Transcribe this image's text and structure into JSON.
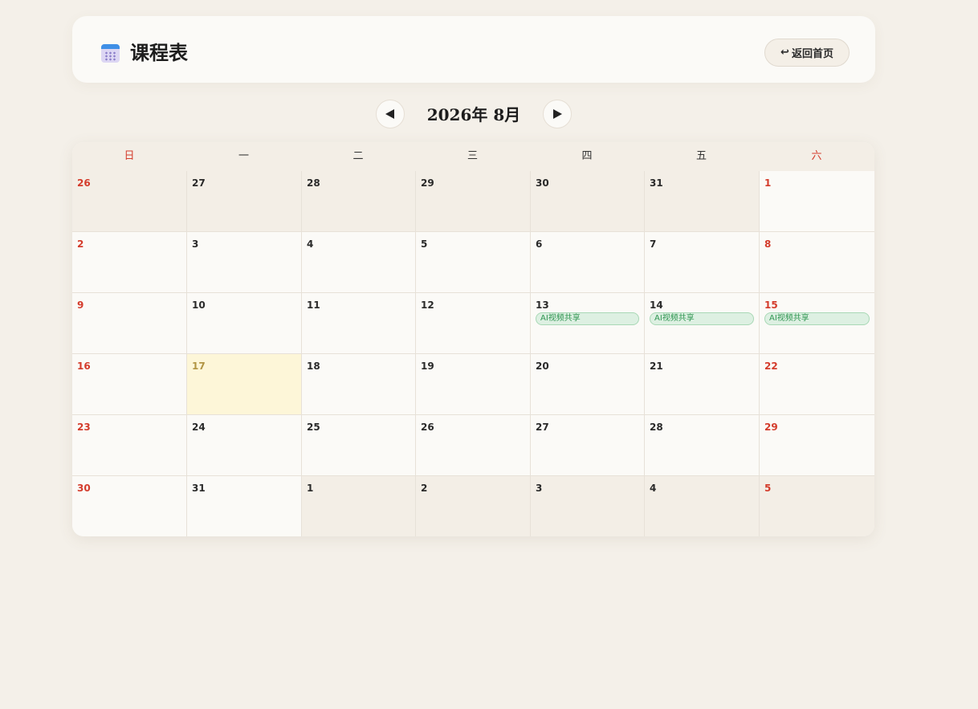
{
  "header": {
    "title": "课程表",
    "icon": "calendar-icon",
    "home_button": {
      "arrow": "↩",
      "label": "返回首页"
    }
  },
  "nav": {
    "month_label": "2026年 8月",
    "prev_icon": "triangle-left-icon",
    "next_icon": "triangle-right-icon"
  },
  "calendar": {
    "weekdays": [
      "日",
      "一",
      "二",
      "三",
      "四",
      "五",
      "六"
    ],
    "weeks": [
      [
        {
          "day": "26",
          "other": true
        },
        {
          "day": "27",
          "other": true
        },
        {
          "day": "28",
          "other": true
        },
        {
          "day": "29",
          "other": true
        },
        {
          "day": "30",
          "other": true
        },
        {
          "day": "31",
          "other": true
        },
        {
          "day": "1"
        }
      ],
      [
        {
          "day": "2"
        },
        {
          "day": "3"
        },
        {
          "day": "4"
        },
        {
          "day": "5"
        },
        {
          "day": "6"
        },
        {
          "day": "7"
        },
        {
          "day": "8"
        }
      ],
      [
        {
          "day": "9"
        },
        {
          "day": "10"
        },
        {
          "day": "11"
        },
        {
          "day": "12"
        },
        {
          "day": "13",
          "event": "AI视频共享"
        },
        {
          "day": "14",
          "event": "AI视频共享"
        },
        {
          "day": "15",
          "event": "AI视频共享"
        }
      ],
      [
        {
          "day": "16"
        },
        {
          "day": "17",
          "today": true
        },
        {
          "day": "18"
        },
        {
          "day": "19"
        },
        {
          "day": "20"
        },
        {
          "day": "21"
        },
        {
          "day": "22"
        }
      ],
      [
        {
          "day": "23"
        },
        {
          "day": "24"
        },
        {
          "day": "25"
        },
        {
          "day": "26"
        },
        {
          "day": "27"
        },
        {
          "day": "28"
        },
        {
          "day": "29"
        }
      ],
      [
        {
          "day": "30"
        },
        {
          "day": "31"
        },
        {
          "day": "1",
          "other": true
        },
        {
          "day": "2",
          "other": true
        },
        {
          "day": "3",
          "other": true
        },
        {
          "day": "4",
          "other": true
        },
        {
          "day": "5",
          "other": true
        }
      ]
    ]
  },
  "colors": {
    "background": "#f4f0e9",
    "weekend": "#d43c2c",
    "today": "#fdf6d8",
    "event_bg": "#ddf0e2",
    "event_text": "#2e9550"
  }
}
